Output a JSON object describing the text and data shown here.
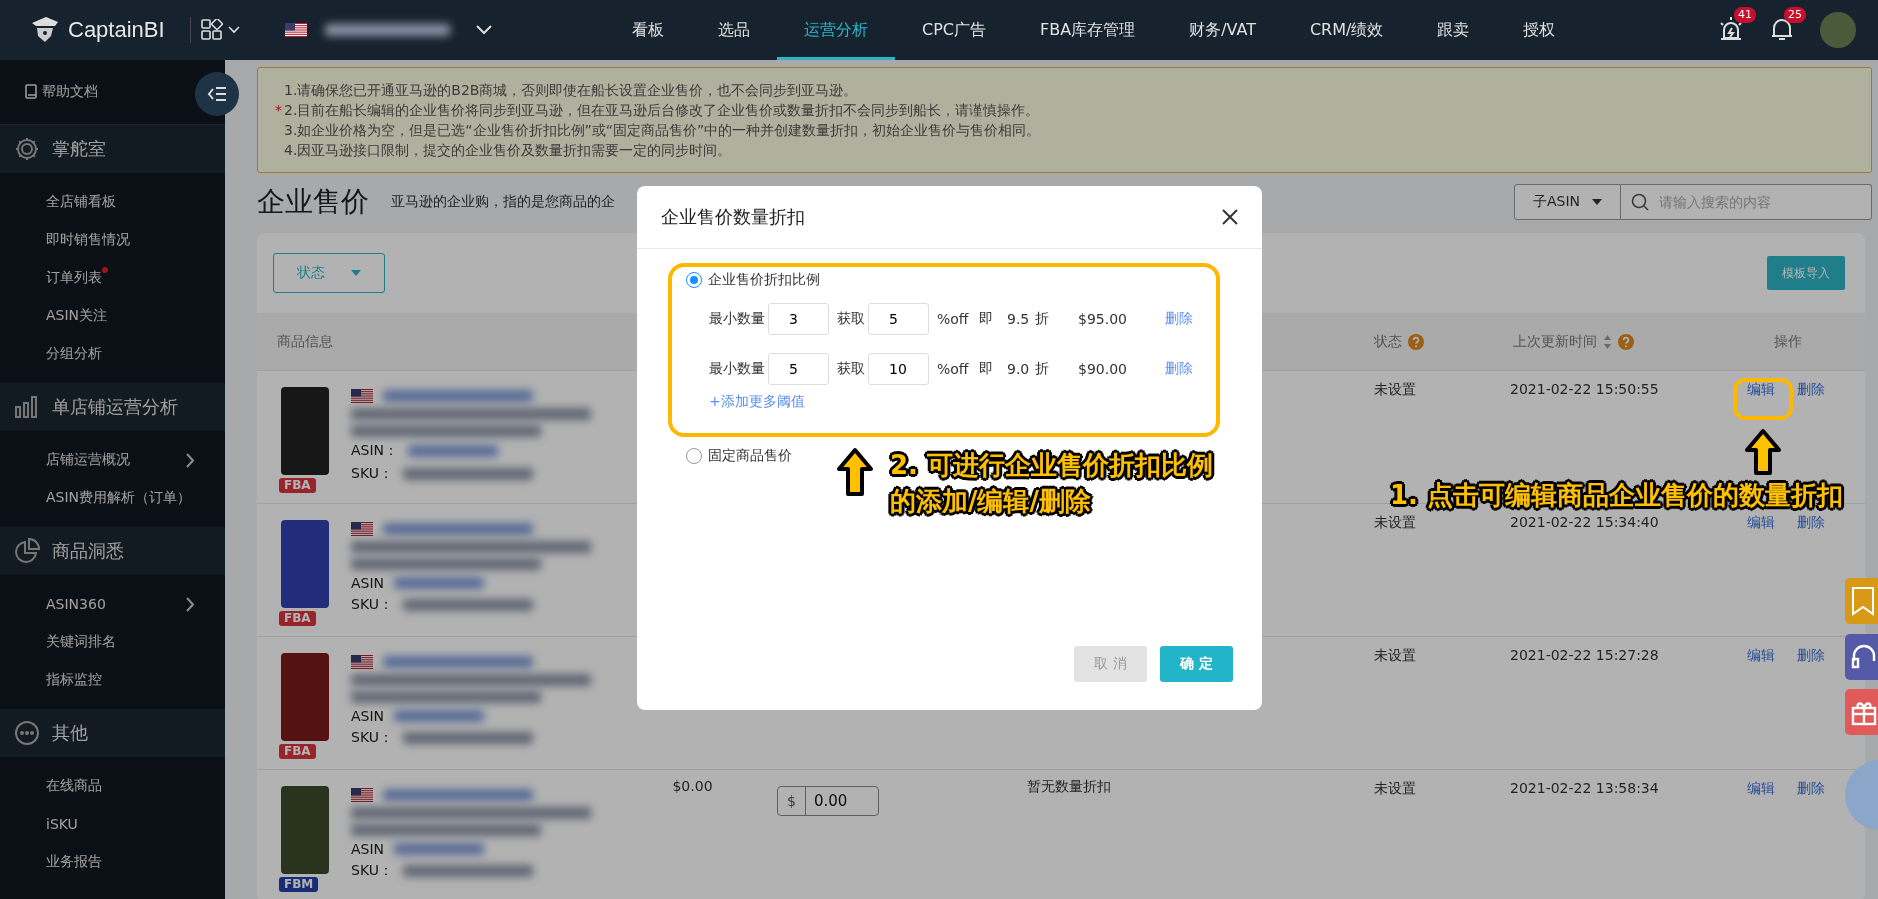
{
  "top_nav": {
    "logo": "CaptainBI",
    "items": [
      {
        "label": "看板",
        "selected": false
      },
      {
        "label": "选品",
        "selected": false
      },
      {
        "label": "运营分析",
        "selected": true
      },
      {
        "label": "CPC广告",
        "selected": false
      },
      {
        "label": "FBA库存管理",
        "selected": false
      },
      {
        "label": "财务/VAT",
        "selected": false
      },
      {
        "label": "CRM/绩效",
        "selected": false
      },
      {
        "label": "跟卖",
        "selected": false
      },
      {
        "label": "授权",
        "selected": false
      }
    ],
    "alerts": [
      {
        "kind": "alarm",
        "count": "41"
      },
      {
        "kind": "bell",
        "count": "25"
      }
    ]
  },
  "sidebar": {
    "help": "帮助文档",
    "sections": [
      {
        "title": "掌舵室",
        "items": [
          {
            "label": "全店铺看板",
            "dot": false,
            "submenu": false
          },
          {
            "label": "即时销售情况",
            "dot": false,
            "submenu": false
          },
          {
            "label": "订单列表",
            "dot": true,
            "submenu": false
          },
          {
            "label": "ASIN关注",
            "dot": false,
            "submenu": false
          },
          {
            "label": "分组分析",
            "dot": false,
            "submenu": false
          }
        ]
      },
      {
        "title": "单店铺运营分析",
        "items": [
          {
            "label": "店铺运营概况",
            "dot": false,
            "submenu": true
          },
          {
            "label": "ASIN费用解析（订单）",
            "dot": false,
            "submenu": false
          }
        ]
      },
      {
        "title": "商品洞悉",
        "items": [
          {
            "label": "ASIN360",
            "dot": false,
            "submenu": true
          },
          {
            "label": "关键词排名",
            "dot": false,
            "submenu": false
          },
          {
            "label": "指标监控",
            "dot": false,
            "submenu": false
          }
        ]
      },
      {
        "title": "其他",
        "items": [
          {
            "label": "在线商品",
            "dot": false,
            "submenu": false
          },
          {
            "label": "iSKU",
            "dot": false,
            "submenu": false
          },
          {
            "label": "业务报告",
            "dot": false,
            "submenu": false
          }
        ]
      }
    ]
  },
  "notice": {
    "lines": [
      {
        "text": "1.请确保您已开通亚马逊的B2B商城，否则即使在船长设置企业售价，也不会同步到亚马逊。"
      },
      {
        "mark": "*",
        "text": "2.目前在船长编辑的企业售价将同步到亚马逊，但在亚马逊后台修改了企业售价或数量折扣不会同步到船长，请谨慎操作。"
      },
      {
        "text": "3.如企业价格为空，但是已选“企业售价折扣比例”或“固定商品售价”中的一种并创建数量折扣，初始企业售价与售价相同。"
      },
      {
        "text": "4.因亚马逊接口限制，提交的企业售价及数量折扣需要一定的同步时间。"
      }
    ]
  },
  "page_header": {
    "title": "企业售价",
    "subtitle": "亚马逊的企业购，指的是您商品的企"
  },
  "search": {
    "scope": "子ASIN",
    "placeholder": "请输入搜索的内容"
  },
  "toolbar": {
    "status_filter": "状态",
    "import_button": "模板导入"
  },
  "table": {
    "columns": [
      {
        "kind": "product",
        "label": "商品信息",
        "help": false,
        "sortable": false
      },
      {
        "kind": "price"
      },
      {
        "kind": "business_price"
      },
      {
        "kind": "discount"
      },
      {
        "kind": "status",
        "label": "状态",
        "help": true,
        "sortable": false
      },
      {
        "kind": "updated",
        "label": "上次更新时间",
        "help": true,
        "sortable": true
      },
      {
        "kind": "action",
        "label": "操作",
        "help": false,
        "sortable": false
      }
    ],
    "rows": [
      {
        "fulfillment": "FBA",
        "kind": "fba",
        "asin_label": "ASIN：",
        "sku_label": "SKU：",
        "status": "未设置",
        "updated": "2021-02-22 15:50:55",
        "actions": [
          "编辑",
          "删除"
        ]
      },
      {
        "fulfillment": "FBA",
        "kind": "fba",
        "asin_label": "ASIN",
        "sku_label": "SKU：",
        "status": "未设置",
        "updated": "2021-02-22 15:34:40",
        "actions": [
          "编辑",
          "删除"
        ]
      },
      {
        "fulfillment": "FBA",
        "kind": "fba",
        "asin_label": "ASIN",
        "sku_label": "SKU：",
        "status": "未设置",
        "updated": "2021-02-22 15:27:28",
        "actions": [
          "编辑",
          "删除"
        ]
      },
      {
        "fulfillment": "FBM",
        "kind": "fbm",
        "asin_label": "ASIN",
        "sku_label": "SKU：",
        "price": "$0.00",
        "currency": "$",
        "business_price": "0.00",
        "discount": "暂无数量折扣",
        "status": "未设置",
        "updated": "2021-02-22 13:58:34",
        "actions": [
          "编辑",
          "删除"
        ]
      }
    ]
  },
  "dialog": {
    "title": "企业售价数量折扣",
    "options": [
      {
        "label": "企业售价折扣比例",
        "selected": true,
        "tiers": [
          {
            "min_label": "最小数量",
            "min": "3",
            "get_label": "获取",
            "percent": "5",
            "unit": "%off",
            "equals": "即",
            "rate": "9.5",
            "rate_unit": "折",
            "price": "$95.00",
            "delete": "删除"
          },
          {
            "min_label": "最小数量",
            "min": "5",
            "get_label": "获取",
            "percent": "10",
            "unit": "%off",
            "equals": "即",
            "rate": "9.0",
            "rate_unit": "折",
            "price": "$90.00",
            "delete": "删除"
          }
        ],
        "add_link": "+添加更多阈值"
      },
      {
        "label": "固定商品售价",
        "selected": false
      }
    ],
    "buttons": [
      {
        "label": "取 消",
        "kind": "secondary"
      },
      {
        "label": "确 定",
        "kind": "primary"
      }
    ]
  },
  "annotations": [
    {
      "text": "2. 可进行企业售价折扣比例的添加/编辑/删除"
    },
    {
      "text": "1. 点击可编辑商品企业售价的数量折扣"
    }
  ]
}
